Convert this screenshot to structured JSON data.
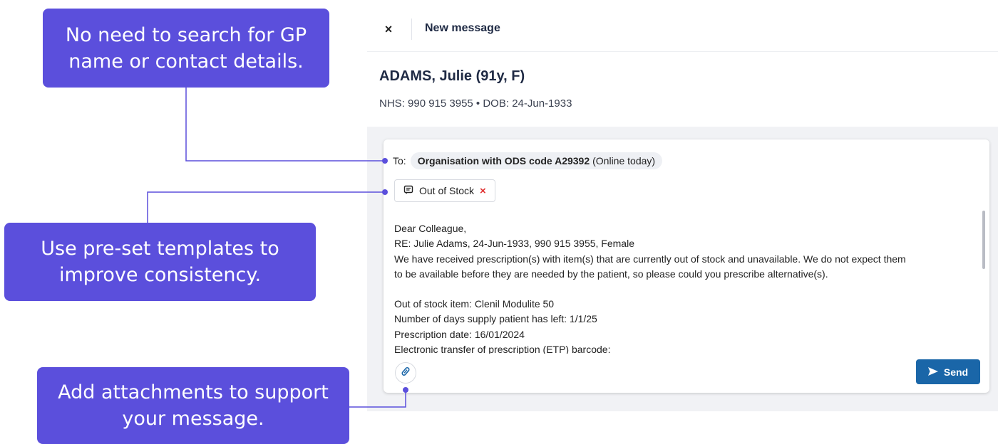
{
  "header": {
    "close_icon": "×",
    "title": "New message"
  },
  "patient": {
    "name": "ADAMS, Julie (91y, F)",
    "meta": "NHS: 990 915 3955 • DOB: 24-Jun-1933"
  },
  "compose": {
    "to_label": "To:",
    "recipient": "Organisation with ODS code A29392",
    "recipient_status": "(Online today)",
    "template_chip": "Out of Stock",
    "template_remove": "×",
    "body_lines": [
      "Dear Colleague,",
      "RE: Julie Adams, 24-Jun-1933, 990 915 3955, Female",
      "We have received prescription(s) with item(s) that are currently out of stock and unavailable. We do not expect them",
      "to be available before they are needed by the patient, so please could you prescribe alternative(s).",
      "",
      "Out of stock item: Clenil Modulite 50",
      "Number of days supply patient has left: 1/1/25",
      "Prescription date: 16/01/2024",
      "Electronic transfer of prescription (ETP) barcode:"
    ],
    "send_label": "Send"
  },
  "callouts": {
    "gp": "No need to search for GP name or contact details.",
    "templates": "Use pre-set templates to improve consistency.",
    "attachments": "Add attachments to support your message."
  },
  "colors": {
    "callout": "#5b4fdc",
    "send_button": "#1a66a8",
    "remove_x": "#e03131",
    "panel_bg": "#f1f2f5"
  },
  "icons": {
    "close": "close-icon",
    "template": "message-template-icon",
    "attach": "paperclip-icon",
    "send": "send-arrow-icon"
  }
}
